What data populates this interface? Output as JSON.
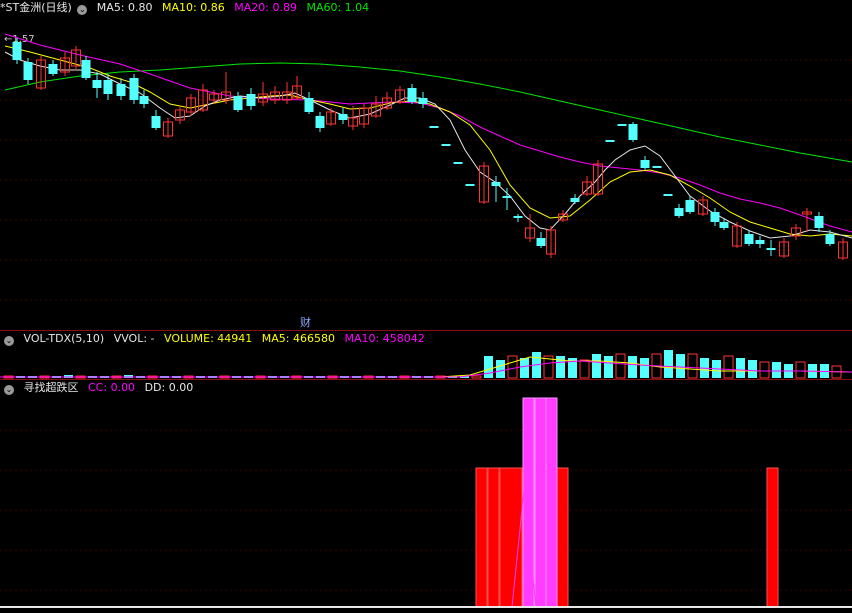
{
  "main": {
    "title": "*ST金洲(日线)",
    "ma5_label": "MA5: 0.80",
    "ma10_label": "MA10: 0.86",
    "ma20_label": "MA20: 0.89",
    "ma60_label": "MA60: 1.04",
    "price_marker": "1.57",
    "event_marker": "财",
    "colors": {
      "up": "#ff3232",
      "down": "#54ffff",
      "ma5": "#ffffff",
      "ma10": "#ffff00",
      "ma20": "#ff00ff",
      "ma60": "#00e600"
    }
  },
  "volume": {
    "title": "VOL-TDX(5,10)",
    "vvol_label": "VVOL: -",
    "volume_label": "VOLUME: 44941",
    "ma5_label": "MA5: 466580",
    "ma10_label": "MA10: 458042"
  },
  "indicator": {
    "title": "寻找超跌区",
    "cc_label": "CC: 0.00",
    "dd_label": "DD: 0.00"
  }
}
